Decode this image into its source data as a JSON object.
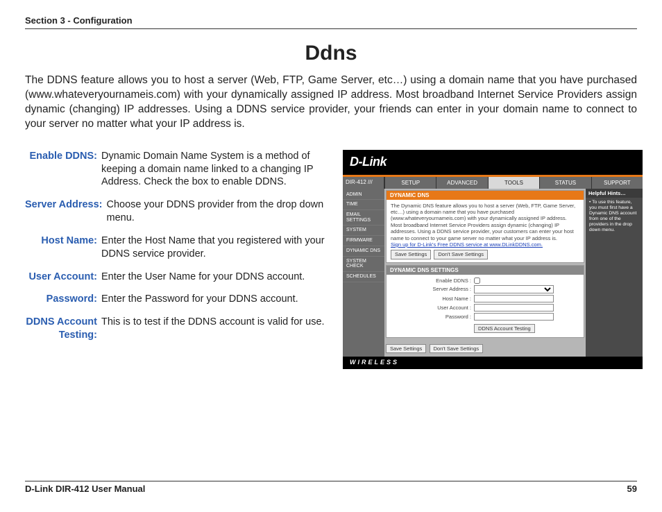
{
  "header": {
    "section": "Section 3 - Configuration"
  },
  "title": "Ddns",
  "intro": "The DDNS feature allows you to host a server (Web, FTP, Game Server, etc…) using a domain name that you have purchased (www.whateveryournameis.com) with your dynamically assigned IP address. Most broadband Internet Service Providers assign dynamic (changing) IP addresses. Using a DDNS service provider, your friends can enter in your domain name to connect to your server no matter what your IP address is.",
  "defs": [
    {
      "label": "Enable DDNS:",
      "text": "Dynamic Domain Name System is a method of keeping a domain name linked to a changing IP Address. Check the box to enable DDNS."
    },
    {
      "label": "Server Address:",
      "text": "Choose your DDNS provider from the drop down menu."
    },
    {
      "label": "Host Name:",
      "text": "Enter the Host Name that you registered with your DDNS service provider."
    },
    {
      "label": "User Account:",
      "text": "Enter the User Name for your DDNS account."
    },
    {
      "label": "Password:",
      "text": "Enter the Password for your DDNS account."
    },
    {
      "label": "DDNS Account Testing:",
      "text": "This is to test if the DDNS account is valid for use."
    }
  ],
  "router": {
    "logo": "D-Link",
    "model": "DIR-412",
    "tabs": [
      "SETUP",
      "ADVANCED",
      "TOOLS",
      "STATUS",
      "SUPPORT"
    ],
    "active_tab": "TOOLS",
    "side": [
      "ADMIN",
      "TIME",
      "EMAIL SETTINGS",
      "SYSTEM",
      "FIRMWARE",
      "DYNAMIC DNS",
      "SYSTEM CHECK",
      "SCHEDULES"
    ],
    "panel1": {
      "title": "DYNAMIC DNS",
      "text": "The Dynamic DNS feature allows you to host a server (Web, FTP, Game Server, etc…) using a domain name that you have purchased (www.whateveryournameis.com) with your dynamically assigned IP address. Most broadband Internet Service Providers assign dynamic (changing) IP addresses. Using a DDNS service provider, your customers can enter your host name to connect to your game server no matter what your IP address is.",
      "signup": "Sign up for D-Link's Free DDNS service at www.DLinkDDNS.com.",
      "btn_save": "Save Settings",
      "btn_nosave": "Don't Save Settings"
    },
    "panel2": {
      "title": "DYNAMIC DNS SETTINGS",
      "rows": [
        "Enable DDNS :",
        "Server Address :",
        "Host Name :",
        "User Account :",
        "Password :"
      ],
      "btn_test": "DDNS Account Testing"
    },
    "footer_btns": {
      "save": "Save Settings",
      "nosave": "Don't Save Settings"
    },
    "hints": {
      "title": "Helpful Hints…",
      "text": "• To use this feature, you must first have a Dynamic DNS account from one of the providers in the drop down menu."
    },
    "foot": "WIRELESS"
  },
  "footer": {
    "manual": "D-Link DIR-412 User Manual",
    "page": "59"
  }
}
